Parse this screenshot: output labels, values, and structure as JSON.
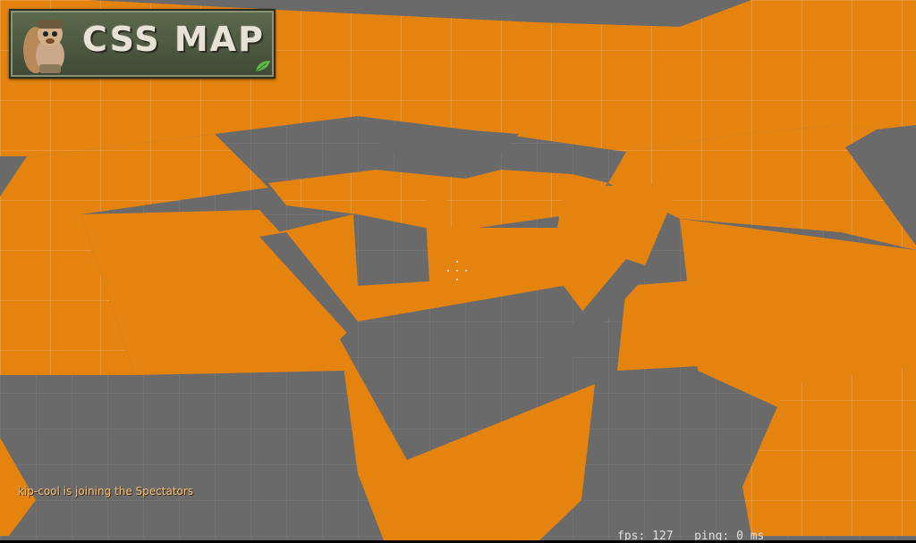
{
  "logo": {
    "text": "CSS MAP"
  },
  "hud": {
    "chat_message": "kip-cool is joining the Spectators",
    "fps_label": "fps:",
    "fps_value": "127",
    "ping_label": "ping:",
    "ping_value": "0 ms"
  },
  "colors": {
    "wall_orange": "#e5830f",
    "floor_gray": "#6a6a6a",
    "chat_text": "#f3c27a",
    "logo_bg": "#4f5a40"
  },
  "icons": {
    "mascot": "squirrel-mascot-icon",
    "leaf": "leaf-icon",
    "crosshair": "crosshair-icon"
  }
}
